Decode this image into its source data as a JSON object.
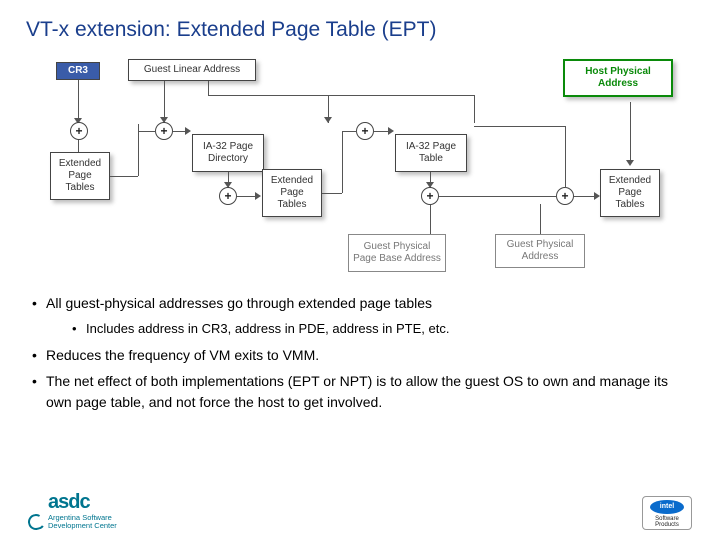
{
  "title": "VT-x extension: Extended Page Table (EPT)",
  "diagram": {
    "cr3": "CR3",
    "gla": "Guest Linear Address",
    "ept": "Extended Page Tables",
    "ia32dir": "IA-32 Page Directory",
    "ia32tbl": "IA-32 Page Table",
    "guestbase": "Guest Physical Page Base Address",
    "guestphys": "Guest Physical Address",
    "hostphys": "Host Physical Address",
    "plus": "+"
  },
  "bullets": {
    "b1": "All guest-physical addresses go through extended page tables",
    "b1a": "Includes address in CR3, address in PDE, address in PTE, etc.",
    "b2": " Reduces the frequency of VM exits to VMM.",
    "b3": " The net effect of both implementations (EPT or NPT) is to allow the guest OS to own and manage its own page table, and not force the host to get involved."
  },
  "footer": {
    "asdc": "asdc",
    "asdc_sub1": "Argentina Software",
    "asdc_sub2": "Development Center",
    "intel": "intel",
    "intel_sw1": "Software",
    "intel_sw2": "Products"
  }
}
